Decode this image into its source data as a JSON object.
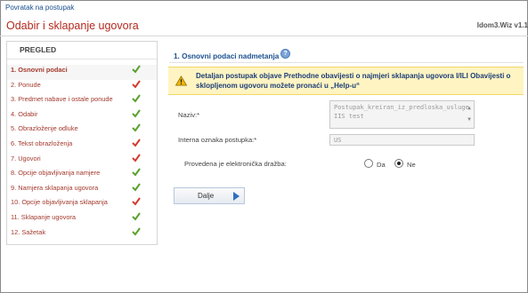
{
  "nav": {
    "back_link": "Povratak na postupak"
  },
  "header": {
    "title": "Odabir i sklapanje ugovora",
    "wizard_id": "Idom3.Wiz v1.1"
  },
  "sidebar": {
    "title": "PREGLED",
    "items": [
      {
        "label": "1. Osnovni podaci",
        "active": true,
        "status": "check-green"
      },
      {
        "label": "2. Ponude",
        "status": "check-red"
      },
      {
        "label": "3. Predmet nabave i ostale ponude",
        "status": "check-green"
      },
      {
        "label": "4. Odabir",
        "status": "check-green"
      },
      {
        "label": "5. Obrazloženje odluke",
        "status": "check-green"
      },
      {
        "label": "6. Tekst obrazloženja",
        "status": "check-red"
      },
      {
        "label": "7. Ugovori",
        "status": "check-red"
      },
      {
        "label": "8. Opcije objavljivanja namjere",
        "status": "check-green"
      },
      {
        "label": "9. Namjera sklapanja ugovora",
        "status": "check-green"
      },
      {
        "label": "10. Opcije objavljivanja sklapanja",
        "status": "check-red"
      },
      {
        "label": "11. Sklapanje ugovora",
        "status": "check-green"
      },
      {
        "label": "12. Sažetak",
        "status": "check-green"
      }
    ]
  },
  "section": {
    "title": "1. Osnovni podaci nadmetanja",
    "help_icon": "help-icon"
  },
  "notice": {
    "icon": "warning-icon",
    "text": "Detaljan postupak objave Prethodne obavijesti o najmjeri sklapanja ugovora I/ILI Obavijesti o sklopljenom ugovoru možete pronaći u „Help-u“"
  },
  "form": {
    "naziv_label": "Naziv:*",
    "naziv_value": "Postupak_kreiran_iz_predloska_usluge IIS test",
    "oznaka_label": "Interna oznaka postupka:*",
    "oznaka_value": "US",
    "drazba_label": "Provedena je elektronička dražba:",
    "drazba_options": [
      {
        "label": "Da",
        "selected": false
      },
      {
        "label": "Ne",
        "selected": true
      }
    ]
  },
  "button": {
    "next_label": "Dalje",
    "icon": "arrow-right-icon"
  },
  "colors": {
    "title_red": "#b42a1f",
    "link_blue": "#1a4f8f",
    "notice_bg": "#fff4c2",
    "check_green": "#5aa02c",
    "check_red": "#d33b2f"
  }
}
